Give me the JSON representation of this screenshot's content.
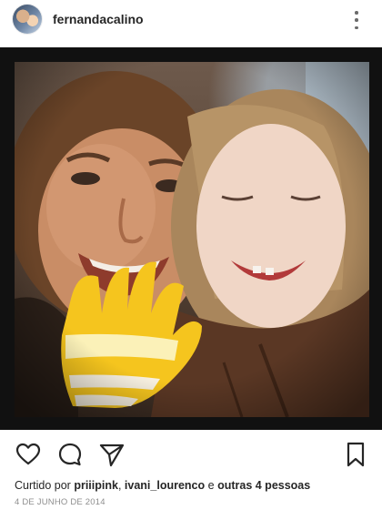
{
  "header": {
    "username": "fernandacalino",
    "avatar_icon": "profile-avatar",
    "more_icon": "more-vertical-icon"
  },
  "post": {
    "image_icon": "post-photo"
  },
  "actions": {
    "like_icon": "heart-icon",
    "comment_icon": "comment-icon",
    "share_icon": "send-icon",
    "save_icon": "bookmark-icon"
  },
  "likes": {
    "prefix": "Curtido por",
    "user1": "priiipink",
    "separator": ",",
    "user2": "ivani_lourenco",
    "conjunction": "e",
    "others": "outras 4 pessoas"
  },
  "date": "4 DE JUNHO DE 2014",
  "colors": {
    "text": "#262626",
    "muted": "#8e8e8e",
    "frame": "#111111"
  }
}
